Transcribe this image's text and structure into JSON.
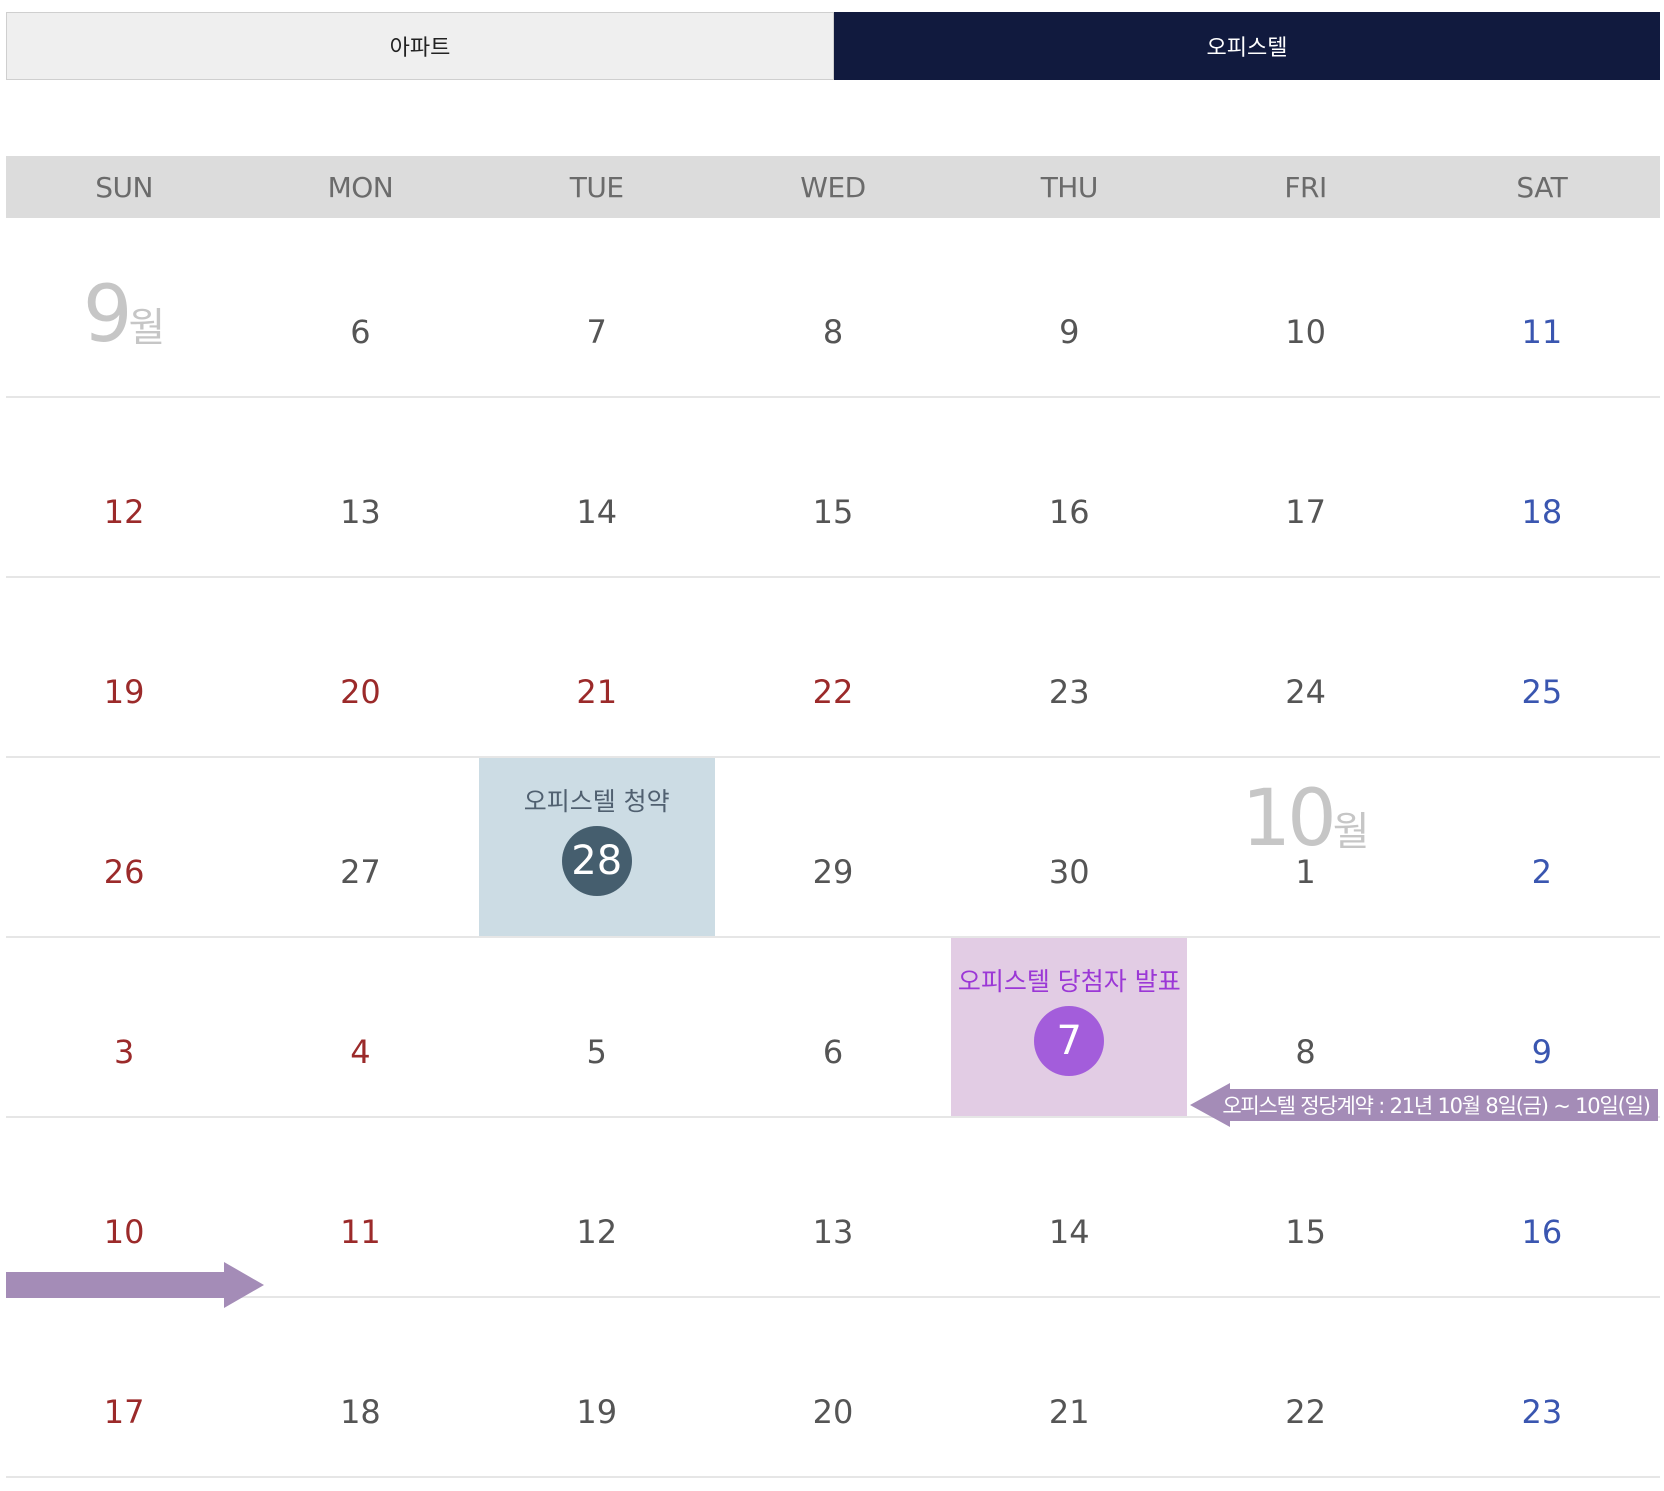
{
  "tabs": [
    {
      "label": "아파트",
      "active": false
    },
    {
      "label": "오피스텔",
      "active": true
    }
  ],
  "weekdays": [
    "SUN",
    "MON",
    "TUE",
    "WED",
    "THU",
    "FRI",
    "SAT"
  ],
  "month_labels": {
    "september": {
      "number": "9",
      "suffix": "월"
    },
    "october": {
      "number": "10",
      "suffix": "월"
    }
  },
  "weeks": [
    [
      "",
      "6",
      "7",
      "8",
      "9",
      "10",
      "11"
    ],
    [
      "12",
      "13",
      "14",
      "15",
      "16",
      "17",
      "18"
    ],
    [
      "19",
      "20",
      "21",
      "22",
      "23",
      "24",
      "25"
    ],
    [
      "26",
      "27",
      "28",
      "29",
      "30",
      "1",
      "2"
    ],
    [
      "3",
      "4",
      "5",
      "6",
      "7",
      "8",
      "9"
    ],
    [
      "10",
      "11",
      "12",
      "13",
      "14",
      "15",
      "16"
    ],
    [
      "17",
      "18",
      "19",
      "20",
      "21",
      "22",
      "23"
    ]
  ],
  "events": {
    "subscription": {
      "label": "오피스텔 청약",
      "day": "28"
    },
    "winner_announcement": {
      "label": "오피스텔 당첨자 발표",
      "day": "7"
    },
    "contract": {
      "label": "오피스텔 정당계약 : 21년 10월 8일(금) ~ 10일(일)"
    }
  },
  "colors": {
    "active_tab": "#111a3e",
    "sunday_holiday": "#9b2a2a",
    "saturday": "#3a56b0",
    "subscription_bg": "#ccdce4",
    "subscription_badge": "#455e6e",
    "winner_bg": "#e2cce4",
    "winner_badge": "#a35ddb",
    "arrow": "#a48cb7"
  }
}
